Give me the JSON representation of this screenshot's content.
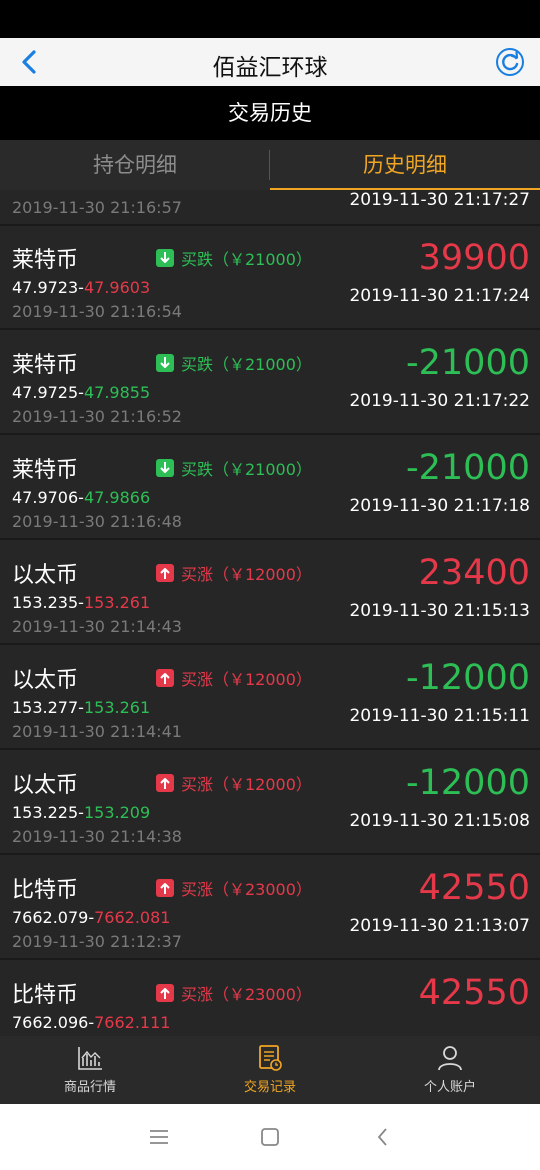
{
  "nav": {
    "title": "佰益汇环球"
  },
  "subheader": {
    "title": "交易历史"
  },
  "tabs": [
    {
      "label": "持仓明细"
    },
    {
      "label": "历史明细"
    }
  ],
  "partial_row": {
    "open_time": "2019-11-30 21:16:57",
    "close_time": "2019-11-30 21:17:27"
  },
  "rows": [
    {
      "name": "莱特币",
      "direction": "down",
      "badge": "买跌（￥21000）",
      "price_open": "47.9723",
      "price_close": "47.9603",
      "price_color": "red",
      "open_time": "2019-11-30 21:16:54",
      "pl": "39900",
      "pl_color": "red",
      "close_time": "2019-11-30 21:17:24"
    },
    {
      "name": "莱特币",
      "direction": "down",
      "badge": "买跌（￥21000）",
      "price_open": "47.9725",
      "price_close": "47.9855",
      "price_color": "green",
      "open_time": "2019-11-30 21:16:52",
      "pl": "-21000",
      "pl_color": "green",
      "close_time": "2019-11-30 21:17:22"
    },
    {
      "name": "莱特币",
      "direction": "down",
      "badge": "买跌（￥21000）",
      "price_open": "47.9706",
      "price_close": "47.9866",
      "price_color": "green",
      "open_time": "2019-11-30 21:16:48",
      "pl": "-21000",
      "pl_color": "green",
      "close_time": "2019-11-30 21:17:18"
    },
    {
      "name": "以太币",
      "direction": "up",
      "badge": "买涨（￥12000）",
      "price_open": "153.235",
      "price_close": "153.261",
      "price_color": "red",
      "open_time": "2019-11-30 21:14:43",
      "pl": "23400",
      "pl_color": "red",
      "close_time": "2019-11-30 21:15:13"
    },
    {
      "name": "以太币",
      "direction": "up",
      "badge": "买涨（￥12000）",
      "price_open": "153.277",
      "price_close": "153.261",
      "price_color": "green",
      "open_time": "2019-11-30 21:14:41",
      "pl": "-12000",
      "pl_color": "green",
      "close_time": "2019-11-30 21:15:11"
    },
    {
      "name": "以太币",
      "direction": "up",
      "badge": "买涨（￥12000）",
      "price_open": "153.225",
      "price_close": "153.209",
      "price_color": "green",
      "open_time": "2019-11-30 21:14:38",
      "pl": "-12000",
      "pl_color": "green",
      "close_time": "2019-11-30 21:15:08"
    },
    {
      "name": "比特币",
      "direction": "up",
      "badge": "买涨（￥23000）",
      "price_open": "7662.079",
      "price_close": "7662.081",
      "price_color": "red",
      "open_time": "2019-11-30 21:12:37",
      "pl": "42550",
      "pl_color": "red",
      "close_time": "2019-11-30 21:13:07"
    },
    {
      "name": "比特币",
      "direction": "up",
      "badge": "买涨（￥23000）",
      "price_open": "7662.096",
      "price_close": "7662.111",
      "price_color": "red",
      "open_time": "",
      "pl": "42550",
      "pl_color": "red",
      "close_time": ""
    }
  ],
  "tabbar": [
    {
      "label": "商品行情",
      "icon": "chart-icon",
      "active": false
    },
    {
      "label": "交易记录",
      "icon": "document-icon",
      "active": true
    },
    {
      "label": "个人账户",
      "icon": "person-icon",
      "active": false
    }
  ],
  "colors": {
    "accent": "#f0a623",
    "red": "#e5394a",
    "green": "#2dbe55"
  }
}
